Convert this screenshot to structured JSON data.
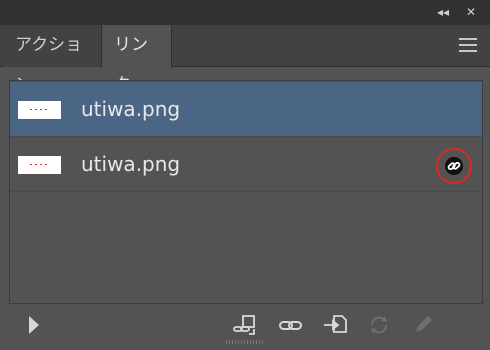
{
  "title_bar": {
    "collapse_glyph": "◂◂",
    "close_glyph": "✕"
  },
  "tabs": [
    {
      "label": "アクション",
      "active": false
    },
    {
      "label": "リンク",
      "active": true
    }
  ],
  "links": [
    {
      "filename": "utiwa.png",
      "selected": true,
      "status_icon": null
    },
    {
      "filename": "utiwa.png",
      "selected": false,
      "status_icon": "embedded-link-icon"
    }
  ],
  "colors": {
    "selected_row": "#4b6584",
    "highlight_ring": "#e0262b",
    "panel_bg": "#535353"
  },
  "toolbar": {
    "icons": [
      "play-icon",
      "relink-cc-library-icon",
      "relink-icon",
      "go-to-link-icon",
      "update-link-icon",
      "edit-original-icon"
    ]
  }
}
